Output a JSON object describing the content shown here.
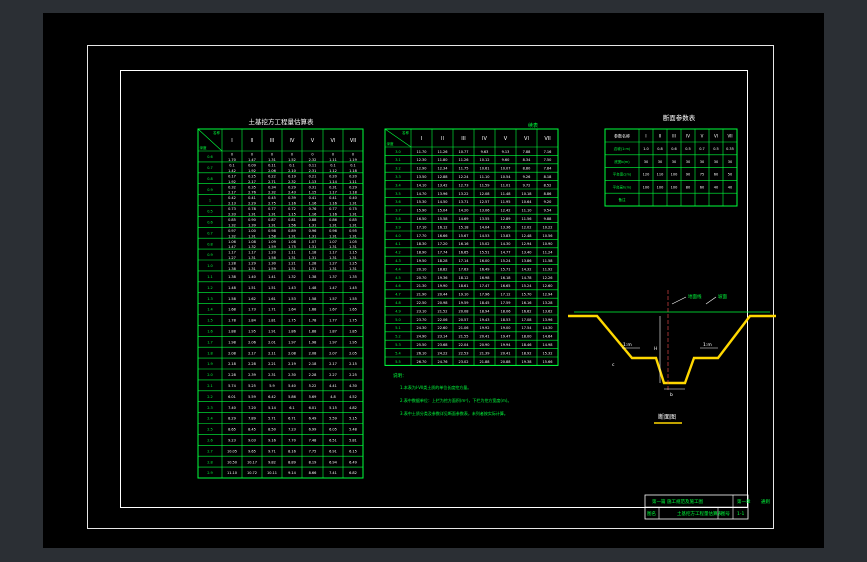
{
  "app": {
    "kind": "CAD drawing viewer"
  },
  "colors": {
    "background": "#000000",
    "line": "#00ff3c",
    "frame": "#ffffff",
    "profile": "#ffd800",
    "window": "#2b2f34"
  },
  "table1": {
    "title": "土基挖方工程量估算表",
    "corner_top": "名称",
    "corner_bottom": "深度",
    "headers": [
      "I",
      "II",
      "III",
      "IV",
      "V",
      "VI",
      "VII"
    ],
    "rows": [
      [
        "0.6",
        "0 1.70",
        "0 1.47",
        "0 1.31",
        "0 1.52",
        "0 2.32",
        "0 1.11",
        "0 1.19"
      ],
      [
        "0.7",
        "0.1 1.42",
        "0.09 1.92",
        "0.11 2.06",
        "0.1 2.10",
        "0.11 2.31",
        "0.1 1.12",
        "0.1 1.18"
      ],
      [
        "0.8",
        "0.17 1.92",
        "0.25 2.17",
        "0.22 2.71",
        "0.19 2.32",
        "0.21 1.13",
        "0.20 1.14",
        "0.20 1.11"
      ],
      [
        "0.9",
        "0.32 2.17",
        "0.35 2.76",
        "0.34 2.32",
        "0.29 2.43",
        "0.31 1.15",
        "0.31 1.17",
        "0.29 1.18"
      ],
      [
        "1",
        "0.42 2.13",
        "0.41 2.29",
        "0.45 2.75",
        "0.39 1.16",
        "0.41 1.16",
        "0.41 1.16",
        "0.40 1.31"
      ],
      [
        "0.5",
        "0.73 2.33",
        "0.78 1.31",
        "0.77 1.31",
        "0.72 1.15",
        "0.76 1.16",
        "0.77 1.16",
        "0.75 1.31"
      ],
      [
        "0.6",
        "0.85 1.32",
        "0.90 1.39",
        "0.87 1.31",
        "0.81 1.56",
        "0.88 1.31",
        "0.86 1.31",
        "0.85 1.31"
      ],
      [
        "0.7",
        "0.97 1.32",
        "1.00 1.31",
        "0.98 1.58",
        "0.89 1.31",
        "0.96 1.31",
        "0.96 1.31",
        "0.95 1.31"
      ],
      [
        "0.8",
        "1.06 1.47",
        "1.08 1.32",
        "1.09 1.59",
        "1.08 1.75",
        "1.07 1.31",
        "1.07 1.31",
        "1.05 1.31"
      ],
      [
        "0.9",
        "1.17 1.27",
        "1.17 1.31",
        "1.20 1.58",
        "1.11 1.31",
        "1.18 1.31",
        "1.17 1.31",
        "1.15 1.31"
      ],
      [
        "1.0",
        "1.28 1.38",
        "1.29 1.31",
        "1.30 1.59",
        "1.21 1.31",
        "1.28 1.31",
        "1.27 1.31",
        "1.25 1.31"
      ],
      [
        "1.1",
        "1.38",
        "1.40",
        "1.41",
        "1.32",
        "1.38",
        "1.37",
        "1.35"
      ],
      [
        "1.2",
        "1.48",
        "1.51",
        "1.51",
        "1.43",
        "1.48",
        "1.47",
        "1.45"
      ],
      [
        "1.3",
        "1.58",
        "1.62",
        "1.61",
        "1.53",
        "1.58",
        "1.57",
        "1.55"
      ],
      [
        "1.4",
        "1.68",
        "1.73",
        "1.71",
        "1.64",
        "1.68",
        "1.67",
        "1.65"
      ],
      [
        "1.5",
        "1.78",
        "1.84",
        "1.81",
        "1.75",
        "1.78",
        "1.77",
        "1.75"
      ],
      [
        "1.6",
        "1.88",
        "1.95",
        "1.91",
        "1.86",
        "1.88",
        "1.87",
        "1.85"
      ],
      [
        "1.7",
        "1.98",
        "2.06",
        "2.01",
        "1.97",
        "1.98",
        "1.97",
        "1.95"
      ],
      [
        "1.8",
        "2.08",
        "2.17",
        "2.11",
        "2.08",
        "2.08",
        "2.07",
        "2.05"
      ],
      [
        "1.9",
        "2.18",
        "2.28",
        "2.21",
        "2.19",
        "2.18",
        "2.17",
        "2.15"
      ],
      [
        "2.0",
        "2.28",
        "2.39",
        "2.31",
        "2.30",
        "2.28",
        "2.27",
        "2.25"
      ],
      [
        "2.1",
        "5.74",
        "5.25",
        "5.9",
        "5.40",
        "5.22",
        "4.41",
        "4.30"
      ],
      [
        "2.2",
        "6.01",
        "5.59",
        "6.42",
        "5.86",
        "5.69",
        "4.8",
        "4.52"
      ],
      [
        "2.3",
        "7.40",
        "7.20",
        "5.14",
        "6.1",
        "6.01",
        "5.15",
        "4.82"
      ],
      [
        "2.4",
        "8.29",
        "7.89",
        "5.71",
        "6.71",
        "6.49",
        "5.59",
        "5.15"
      ],
      [
        "2.5",
        "8.65",
        "8.45",
        "8.50",
        "7.23",
        "6.99",
        "6.05",
        "5.48"
      ],
      [
        "2.6",
        "9.23",
        "9.03",
        "9.16",
        "7.70",
        "7.48",
        "6.51",
        "5.81"
      ],
      [
        "2.7",
        "10.05",
        "9.65",
        "9.71",
        "8.16",
        "7.75",
        "6.91",
        "6.15"
      ],
      [
        "2.8",
        "10.50",
        "10.17",
        "9.82",
        "8.89",
        "8.19",
        "6.94",
        "6.49"
      ],
      [
        "2.9",
        "11.10",
        "10.72",
        "10.11",
        "9.14",
        "8.66",
        "7.41",
        "6.82"
      ]
    ]
  },
  "table2": {
    "note": "续表",
    "corner_top": "名称",
    "corner_bottom": "深度",
    "headers": [
      "I",
      "II",
      "III",
      "IV",
      "V",
      "VI",
      "VII"
    ],
    "rows": [
      [
        "3.0",
        "11.70",
        "11.26",
        "10.77",
        "9.63",
        "9.13",
        "7.88",
        "7.16"
      ],
      [
        "3.1",
        "12.30",
        "11.80",
        "11.26",
        "10.12",
        "9.60",
        "8.34",
        "7.50"
      ],
      [
        "3.2",
        "12.90",
        "12.34",
        "11.75",
        "10.61",
        "10.07",
        "8.80",
        "7.84"
      ],
      [
        "3.3",
        "13.50",
        "12.88",
        "12.24",
        "11.10",
        "10.54",
        "9.26",
        "8.18"
      ],
      [
        "3.4",
        "14.10",
        "13.42",
        "12.73",
        "11.59",
        "11.01",
        "9.72",
        "8.52"
      ],
      [
        "3.5",
        "14.70",
        "13.96",
        "13.22",
        "12.08",
        "11.48",
        "10.18",
        "8.86"
      ],
      [
        "3.6",
        "15.30",
        "14.50",
        "13.71",
        "12.57",
        "11.95",
        "10.64",
        "9.20"
      ],
      [
        "3.7",
        "15.90",
        "15.04",
        "14.20",
        "13.06",
        "12.42",
        "11.10",
        "9.54"
      ],
      [
        "3.8",
        "16.50",
        "15.58",
        "14.69",
        "13.55",
        "12.89",
        "11.56",
        "9.88"
      ],
      [
        "3.9",
        "17.10",
        "16.12",
        "15.18",
        "14.04",
        "13.36",
        "12.02",
        "10.22"
      ],
      [
        "4.0",
        "17.70",
        "16.66",
        "15.67",
        "14.53",
        "13.83",
        "12.48",
        "10.56"
      ],
      [
        "4.1",
        "18.30",
        "17.20",
        "16.16",
        "15.02",
        "14.30",
        "12.94",
        "10.90"
      ],
      [
        "4.2",
        "18.90",
        "17.74",
        "16.65",
        "15.51",
        "14.77",
        "13.40",
        "11.24"
      ],
      [
        "4.3",
        "19.50",
        "18.28",
        "17.14",
        "16.00",
        "15.24",
        "13.86",
        "11.58"
      ],
      [
        "4.4",
        "20.10",
        "18.82",
        "17.63",
        "16.49",
        "15.71",
        "14.32",
        "11.92"
      ],
      [
        "4.5",
        "20.70",
        "19.36",
        "18.12",
        "16.98",
        "16.18",
        "14.78",
        "12.26"
      ],
      [
        "4.6",
        "21.30",
        "19.90",
        "18.61",
        "17.47",
        "16.65",
        "15.24",
        "12.60"
      ],
      [
        "4.7",
        "21.90",
        "20.44",
        "19.10",
        "17.96",
        "17.12",
        "15.70",
        "12.94"
      ],
      [
        "4.8",
        "22.50",
        "20.98",
        "19.59",
        "18.45",
        "17.59",
        "16.16",
        "13.28"
      ],
      [
        "4.9",
        "23.10",
        "21.52",
        "20.08",
        "18.94",
        "18.06",
        "16.62",
        "13.62"
      ],
      [
        "5.0",
        "23.70",
        "22.06",
        "20.57",
        "19.43",
        "18.53",
        "17.08",
        "13.96"
      ],
      [
        "5.1",
        "24.30",
        "22.60",
        "21.06",
        "19.92",
        "19.00",
        "17.54",
        "14.30"
      ],
      [
        "5.2",
        "24.90",
        "23.14",
        "21.55",
        "20.41",
        "19.47",
        "18.00",
        "14.64"
      ],
      [
        "5.3",
        "25.50",
        "23.68",
        "22.04",
        "20.90",
        "19.94",
        "18.46",
        "14.98"
      ],
      [
        "5.4",
        "26.10",
        "24.22",
        "22.53",
        "21.39",
        "20.41",
        "18.92",
        "15.32"
      ],
      [
        "5.5",
        "26.70",
        "24.76",
        "23.02",
        "21.88",
        "20.88",
        "19.38",
        "15.66"
      ]
    ]
  },
  "table3": {
    "title": "断面参数表",
    "headers": [
      "参数名称",
      "I",
      "II",
      "III",
      "IV",
      "V",
      "VI",
      "VII"
    ],
    "rows": [
      [
        "边坡(1:m)",
        "1.0",
        "0.8",
        "0.6",
        "0.5",
        "0.7",
        "0.5",
        "0.35"
      ],
      [
        "底宽b(m)",
        "30",
        "30",
        "30",
        "30",
        "30",
        "30",
        "30"
      ],
      [
        "平台宽c(m)",
        "120",
        "110",
        "100",
        "90",
        "75",
        "60",
        "50"
      ],
      [
        "平台高h(m)",
        "100",
        "100",
        "100",
        "80",
        "60",
        "40",
        "40"
      ],
      [
        "备注",
        "",
        "",
        "",
        "",
        "",
        "",
        ""
      ]
    ]
  },
  "notes": {
    "heading": "说明：",
    "lines": [
      "1.本表为I-VII类土质的单位长度挖方量。",
      "2.表中数据单位：上栏为挖方面积(m²)，下栏为挖方宽度(m)。",
      "3.表中土质分类及参数详见断面参数表，未列者按实际计算。"
    ]
  },
  "section": {
    "labels": {
      "ground": "地面线",
      "slope": "坡面",
      "berm_left": "1:m",
      "berm_right": "1:m",
      "depth": "H",
      "bottom": "b",
      "side": "c",
      "title": "断面图"
    }
  },
  "title_block": {
    "row1": [
      "第一篇",
      "施工规范及施工图",
      "第一章",
      "通则"
    ],
    "row2": [
      "图名",
      "土基挖方工程量估算表",
      "图号",
      "1-1"
    ]
  }
}
